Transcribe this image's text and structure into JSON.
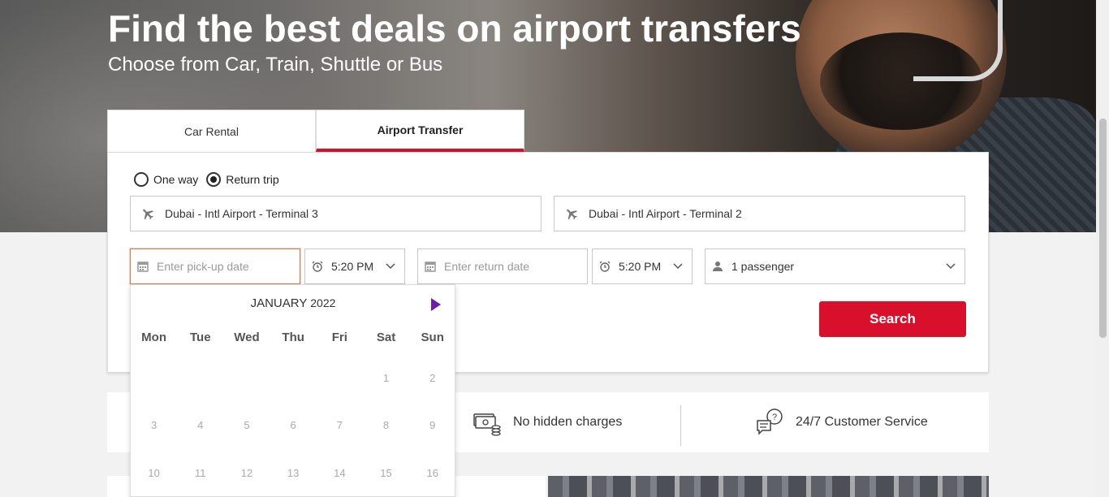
{
  "hero": {
    "title": "Find the best deals on airport transfers",
    "subtitle": "Choose from Car, Train, Shuttle or Bus"
  },
  "tabs": [
    {
      "label": "Car Rental",
      "active": false
    },
    {
      "label": "Airport Transfer",
      "active": true
    }
  ],
  "trip_type": {
    "options": [
      {
        "label": "One way",
        "selected": false
      },
      {
        "label": "Return trip",
        "selected": true
      }
    ]
  },
  "pickup_location": {
    "value": "Dubai - Intl Airport - Terminal 3",
    "icon": "plane-icon"
  },
  "dropoff_location": {
    "value": "Dubai - Intl Airport - Terminal 2",
    "icon": "plane-icon"
  },
  "pickup_date": {
    "placeholder": "Enter pick-up date",
    "icon": "calendar-icon"
  },
  "pickup_time": {
    "value": "5:20 PM",
    "icon": "alarm-clock-icon"
  },
  "return_date": {
    "placeholder": "Enter return date",
    "icon": "calendar-icon"
  },
  "return_time": {
    "value": "5:20 PM",
    "icon": "alarm-clock-icon"
  },
  "passengers": {
    "value": "1 passenger",
    "icon": "person-icon"
  },
  "search_button": {
    "label": "Search",
    "color": "#d8102c"
  },
  "calendar": {
    "month": "JANUARY",
    "year": "2022",
    "weekdays": [
      "Mon",
      "Tue",
      "Wed",
      "Thu",
      "Fri",
      "Sat",
      "Sun"
    ],
    "weeks": [
      [
        "",
        "",
        "",
        "",
        "",
        "1",
        "2"
      ],
      [
        "3",
        "4",
        "5",
        "6",
        "7",
        "8",
        "9"
      ],
      [
        "10",
        "11",
        "12",
        "13",
        "14",
        "15",
        "16"
      ]
    ],
    "accent": "#6b1fa6"
  },
  "features": [
    {
      "label": "No hidden charges",
      "icon": "money-stack-icon"
    },
    {
      "label": "24/7 Customer Service",
      "icon": "chat-question-icon"
    }
  ]
}
